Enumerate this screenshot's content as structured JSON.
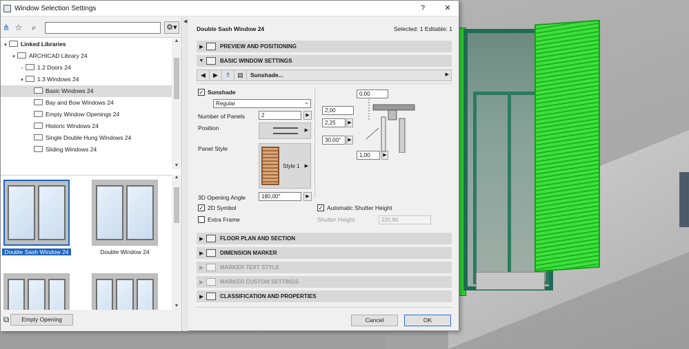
{
  "window": {
    "title": "Window Selection Settings",
    "help": "?",
    "close": "✕"
  },
  "library": {
    "tree": [
      {
        "label": "Linked Libraries",
        "level": 0,
        "expanded": true,
        "bold": true
      },
      {
        "label": "ARCHICAD Library 24",
        "level": 1,
        "expanded": true
      },
      {
        "label": "1.2 Doors 24",
        "level": 2,
        "expanded": false
      },
      {
        "label": "1.3 Windows 24",
        "level": 2,
        "expanded": true
      },
      {
        "label": "Basic Windows 24",
        "level": 3,
        "selected": true
      },
      {
        "label": "Bay and Bow Windows 24",
        "level": 3
      },
      {
        "label": "Empty Window Openings 24",
        "level": 3
      },
      {
        "label": "Historic Windows 24",
        "level": 3
      },
      {
        "label": "Single Double Hung Windows 24",
        "level": 3
      },
      {
        "label": "Sliding Windows 24",
        "level": 3
      }
    ],
    "thumbnails": [
      {
        "caption": "Double Sash Window 24",
        "selected": true,
        "panes": 2
      },
      {
        "caption": "Double Window 24",
        "selected": false,
        "panes": 2
      },
      {
        "caption": "",
        "selected": false,
        "panes": 3
      },
      {
        "caption": "",
        "selected": false,
        "panes": 3
      }
    ],
    "empty_opening_label": "Empty Opening"
  },
  "settings": {
    "object_name": "Double Sash Window 24",
    "selection_info": "Selected: 1 Editable: 1",
    "sections": {
      "preview": "PREVIEW AND POSITIONING",
      "basic": "BASIC WINDOW SETTINGS",
      "floor_plan": "FLOOR PLAN AND SECTION",
      "dimension": "DIMENSION MARKER",
      "marker_text": "MARKER TEXT STYLE",
      "marker_custom": "MARKER CUSTOM SETTINGS",
      "classification": "CLASSIFICATION AND PROPERTIES"
    },
    "subpage": "Sunshade...",
    "sunshade_label": "Sunshade",
    "sunshade_checked": true,
    "sunshade_type": "Regular",
    "panels_label": "Number of Panels",
    "panels_value": "2",
    "position_label": "Position",
    "panel_style_label": "Panel Style",
    "panel_style_value": "Style 1",
    "opening_angle_label": "3D Opening Angle",
    "opening_angle_value": "180,00°",
    "symbol_2d_label": "2D Symbol",
    "symbol_2d_checked": true,
    "extra_frame_label": "Extra Frame",
    "extra_frame_checked": false,
    "auto_shutter_label": "Automatic Shutter Height",
    "auto_shutter_checked": true,
    "shutter_height_label": "Shutter Height",
    "shutter_height_value": "220,80",
    "diagram": {
      "top": "0,00",
      "a": "2,00",
      "b": "2,25",
      "angle": "30,00°",
      "bottom": "1,00"
    }
  },
  "buttons": {
    "cancel": "Cancel",
    "ok": "OK"
  },
  "colors": {
    "shutter_green": "#33d233",
    "selection_blue": "#1e63c4",
    "section_gray": "#d8d8d8"
  }
}
